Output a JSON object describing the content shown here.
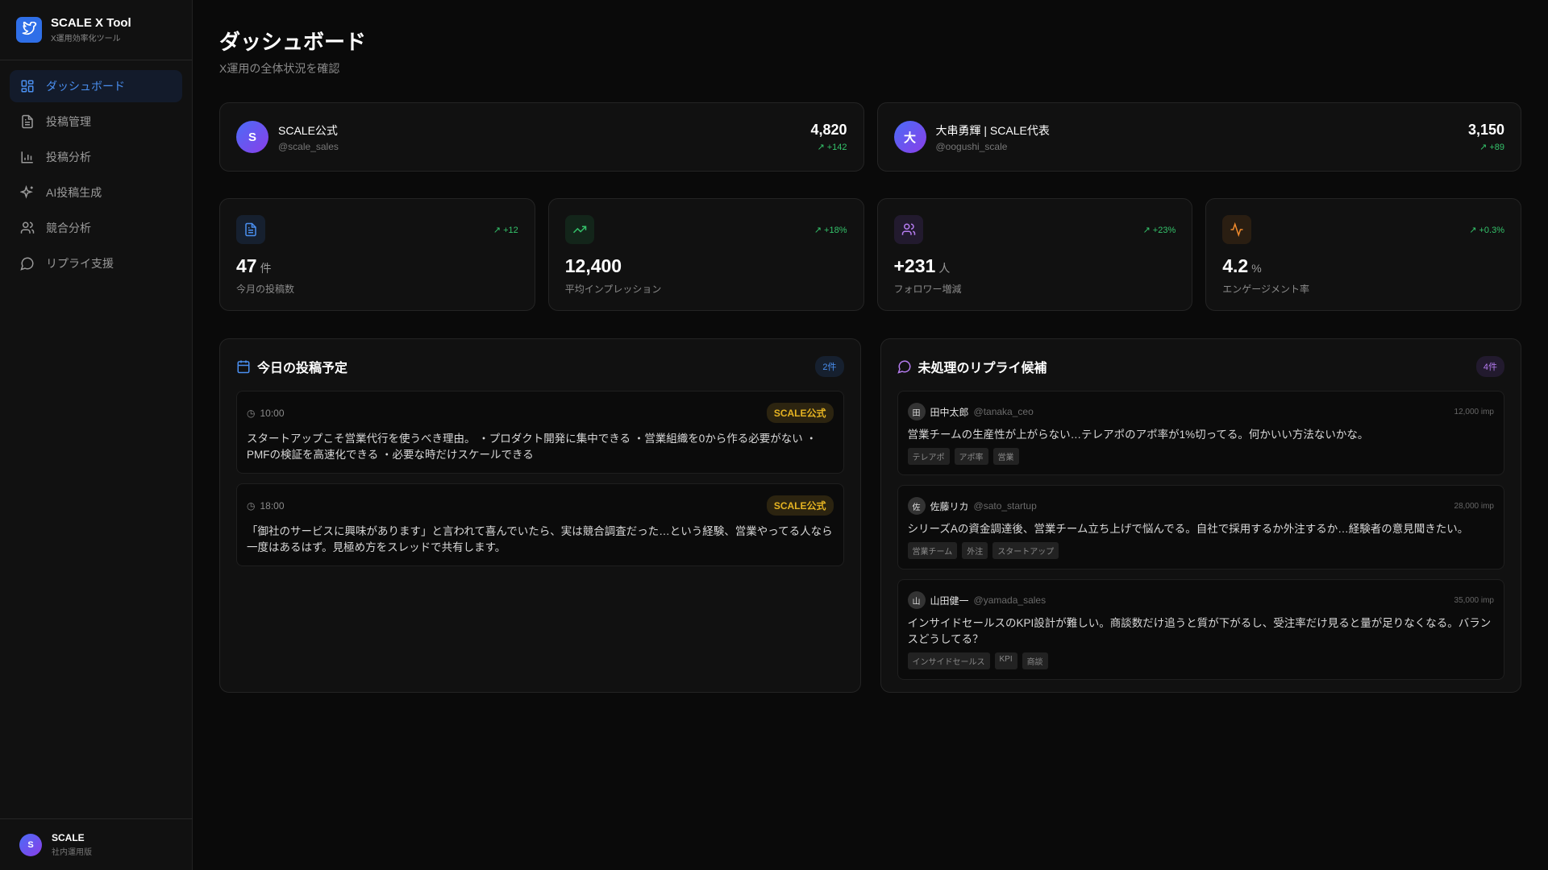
{
  "brand": {
    "title": "SCALE X Tool",
    "subtitle": "X運用効率化ツール"
  },
  "nav": [
    {
      "label": "ダッシュボード",
      "icon": "grid-icon"
    },
    {
      "label": "投稿管理",
      "icon": "document-icon"
    },
    {
      "label": "投稿分析",
      "icon": "bar-chart-icon"
    },
    {
      "label": "AI投稿生成",
      "icon": "sparkles-icon"
    },
    {
      "label": "競合分析",
      "icon": "users-icon"
    },
    {
      "label": "リプライ支援",
      "icon": "message-icon"
    }
  ],
  "footer": {
    "avatar": "S",
    "name": "SCALE",
    "sub": "社内運用版"
  },
  "page": {
    "title": "ダッシュボード",
    "subtitle": "X運用の全体状況を確認"
  },
  "accounts": [
    {
      "avatar": "S",
      "name": "SCALE公式",
      "handle": "@scale_sales",
      "followers": "4,820",
      "delta": "+142"
    },
    {
      "avatar": "大",
      "name": "大串勇輝 | SCALE代表",
      "handle": "@oogushi_scale",
      "followers": "3,150",
      "delta": "+89"
    }
  ],
  "stats": [
    {
      "value": "47",
      "unit": "件",
      "label": "今月の投稿数",
      "delta": "+12",
      "color": "#4a8ff0"
    },
    {
      "value": "12,400",
      "unit": "",
      "label": "平均インプレッション",
      "delta": "+18%",
      "color": "#34c26a"
    },
    {
      "value": "+231",
      "unit": "人",
      "label": "フォロワー増減",
      "delta": "+23%",
      "color": "#b57cf0"
    },
    {
      "value": "4.2",
      "unit": "%",
      "label": "エンゲージメント率",
      "delta": "+0.3%",
      "color": "#f08a2c"
    }
  ],
  "schedule": {
    "title": "今日の投稿予定",
    "count": "2件",
    "items": [
      {
        "time": "10:00",
        "account": "SCALE公式",
        "text": "スタートアップこそ営業代行を使うべき理由。 ・プロダクト開発に集中できる ・営業組織を0から作る必要がない ・PMFの検証を高速化できる ・必要な時だけスケールできる"
      },
      {
        "time": "18:00",
        "account": "SCALE公式",
        "text": "「御社のサービスに興味があります」と言われて喜んでいたら、実は競合調査だった…という経験、営業やってる人なら一度はあるはず。見極め方をスレッドで共有します。"
      }
    ]
  },
  "replies": {
    "title": "未処理のリプライ候補",
    "count": "4件",
    "items": [
      {
        "avatar": "田",
        "name": "田中太郎",
        "handle": "@tanaka_ceo",
        "imp": "12,000 imp",
        "text": "営業チームの生産性が上がらない…テレアポのアポ率が1%切ってる。何かいい方法ないかな。",
        "tags": [
          "テレアポ",
          "アポ率",
          "営業"
        ]
      },
      {
        "avatar": "佐",
        "name": "佐藤リカ",
        "handle": "@sato_startup",
        "imp": "28,000 imp",
        "text": "シリーズAの資金調達後、営業チーム立ち上げで悩んでる。自社で採用するか外注するか…経験者の意見聞きたい。",
        "tags": [
          "営業チーム",
          "外注",
          "スタートアップ"
        ]
      },
      {
        "avatar": "山",
        "name": "山田健一",
        "handle": "@yamada_sales",
        "imp": "35,000 imp",
        "text": "インサイドセールスのKPI設計が難しい。商談数だけ追うと質が下がるし、受注率だけ見ると量が足りなくなる。バランスどうしてる？",
        "tags": [
          "インサイドセールス",
          "KPI",
          "商談"
        ]
      }
    ]
  }
}
